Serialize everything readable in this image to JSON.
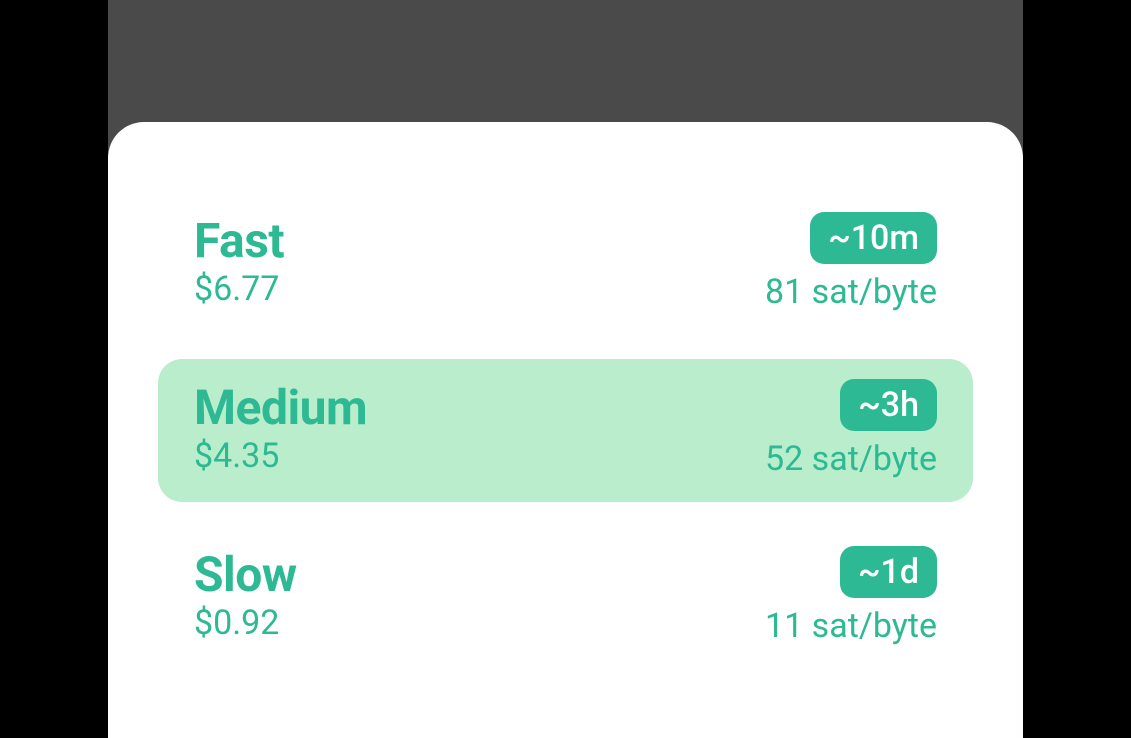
{
  "feeOptions": [
    {
      "id": "fast",
      "name": "Fast",
      "price": "$6.77",
      "time": "~10m",
      "rate": "81 sat/byte",
      "selected": false
    },
    {
      "id": "medium",
      "name": "Medium",
      "price": "$4.35",
      "time": "~3h",
      "rate": "52 sat/byte",
      "selected": true
    },
    {
      "id": "slow",
      "name": "Slow",
      "price": "$0.92",
      "time": "~1d",
      "rate": "11 sat/byte",
      "selected": false
    }
  ]
}
